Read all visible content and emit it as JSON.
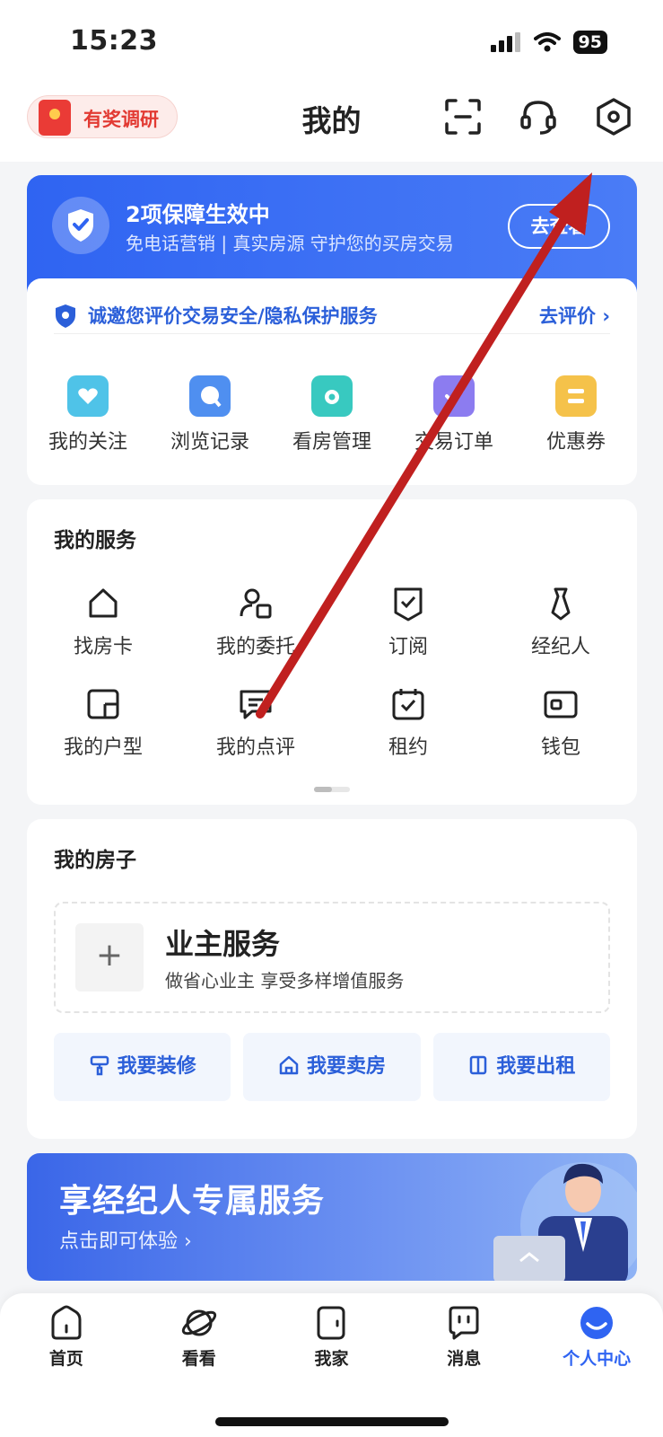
{
  "status_bar": {
    "time": "15:23",
    "battery": "95"
  },
  "header": {
    "survey_label": "有奖调研",
    "title": "我的"
  },
  "guarantee": {
    "title": "2项保障生效中",
    "subtitle": "免电话营销 | 真实房源 守护您的买房交易",
    "button": "去查看"
  },
  "rating": {
    "text": "诚邀您评价交易安全/隐私保护服务",
    "link": "去评价 ›"
  },
  "quick_actions": [
    {
      "label": "我的关注",
      "icon": "heart-folder-icon",
      "color": "#4fc3e8"
    },
    {
      "label": "浏览记录",
      "icon": "chat-bubble-icon",
      "color": "#4f8ff0"
    },
    {
      "label": "看房管理",
      "icon": "folder-eye-icon",
      "color": "#38c9c0"
    },
    {
      "label": "交易订单",
      "icon": "clipboard-check-icon",
      "color": "#8c7cf0"
    },
    {
      "label": "优惠券",
      "icon": "ticket-icon",
      "color": "#f5c24a"
    }
  ],
  "services": {
    "title": "我的服务",
    "items": [
      {
        "label": "找房卡",
        "icon": "house-card-icon"
      },
      {
        "label": "我的委托",
        "icon": "user-delegate-icon"
      },
      {
        "label": "订阅",
        "icon": "bookmark-check-icon"
      },
      {
        "label": "经纪人",
        "icon": "agent-tie-icon"
      },
      {
        "label": "我的户型",
        "icon": "floor-plan-icon"
      },
      {
        "label": "我的点评",
        "icon": "comment-icon"
      },
      {
        "label": "租约",
        "icon": "calendar-check-icon"
      },
      {
        "label": "钱包",
        "icon": "wallet-icon"
      }
    ]
  },
  "house": {
    "title": "我的房子",
    "owner_title": "业主服务",
    "owner_sub": "做省心业主 享受多样增值服务",
    "plus": "+",
    "actions": [
      {
        "label": "我要装修",
        "icon": "paint-roller-icon"
      },
      {
        "label": "我要卖房",
        "icon": "house-icon"
      },
      {
        "label": "我要出租",
        "icon": "door-icon"
      }
    ]
  },
  "banner": {
    "title": "享经纪人专属服务",
    "subtitle": "点击即可体验 ›"
  },
  "tabs": [
    {
      "label": "首页",
      "icon": "home-icon"
    },
    {
      "label": "看看",
      "icon": "planet-icon"
    },
    {
      "label": "我家",
      "icon": "door-home-icon"
    },
    {
      "label": "消息",
      "icon": "message-icon"
    },
    {
      "label": "个人中心",
      "icon": "profile-smile-icon",
      "active": true
    }
  ],
  "colors": {
    "primary": "#2f64f2",
    "annotation_arrow": "#c0201f"
  }
}
